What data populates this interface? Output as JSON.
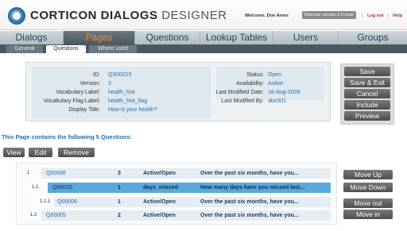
{
  "header": {
    "brand_1": "CORTICON",
    "brand_2": "DIALOGS",
    "brand_3": "DESIGNER",
    "welcome": "Welcome, Don Ames",
    "discover": "Discover version 2.0 now!",
    "logout": "Log out",
    "help": "Help"
  },
  "main_tabs": [
    "Dialogs",
    "Pages",
    "Questions",
    "Lookup Tables",
    "Users",
    "Groups"
  ],
  "active_main_tab": "Pages",
  "sub_tabs": [
    "General",
    "Questions",
    "Where used"
  ],
  "active_sub_tab": "Questions",
  "page_info": {
    "id_label": "ID:",
    "id": "QS00015",
    "version_label": "Version:",
    "version": "3",
    "vocab_label": "Vocabulary Label:",
    "vocab": "health_hist",
    "flag_label": "Vocabulary Flag Label:",
    "flag": "health_hist_flag",
    "title_label": "Display Title:",
    "title": "How is your health?",
    "status_label": "Status:",
    "status": "Open",
    "avail_label": "Availability:",
    "avail": "Active",
    "modified_label": "Last Modified Date:",
    "modified": "18-Aug-2008",
    "by_label": "Last Modified By:",
    "by": "abc001"
  },
  "actions": [
    "Save",
    "Save & Exit",
    "Cancel",
    "Include",
    "Preview"
  ],
  "questions_heading": "This Page contains the following 5 Questions:",
  "table_buttons": [
    "View",
    "Edit",
    "Remove"
  ],
  "rows": [
    {
      "num": "1",
      "id": "Q00006",
      "count": "3",
      "status": "Active/Open",
      "text": "Over the past six months, have you..."
    },
    {
      "num": "1.1",
      "id": "Q00015",
      "count": "1",
      "status": "days_missed",
      "text": "How many days have you missed last..."
    },
    {
      "num": "1.1.1",
      "id": "Q00006",
      "count": "1",
      "status": "Active/Open",
      "text": "Over the past six months, have you..."
    },
    {
      "num": "1.2",
      "id": "Q00005",
      "count": "2",
      "status": "Active/Open",
      "text": "Over the past six months, have you..."
    }
  ],
  "move_buttons": [
    "Move Up",
    "Move Down",
    "Move out",
    "Move in"
  ],
  "colors": {
    "accent": "#f08a24",
    "link": "#1f6fb0",
    "selected_row": "#5aa9dc"
  }
}
